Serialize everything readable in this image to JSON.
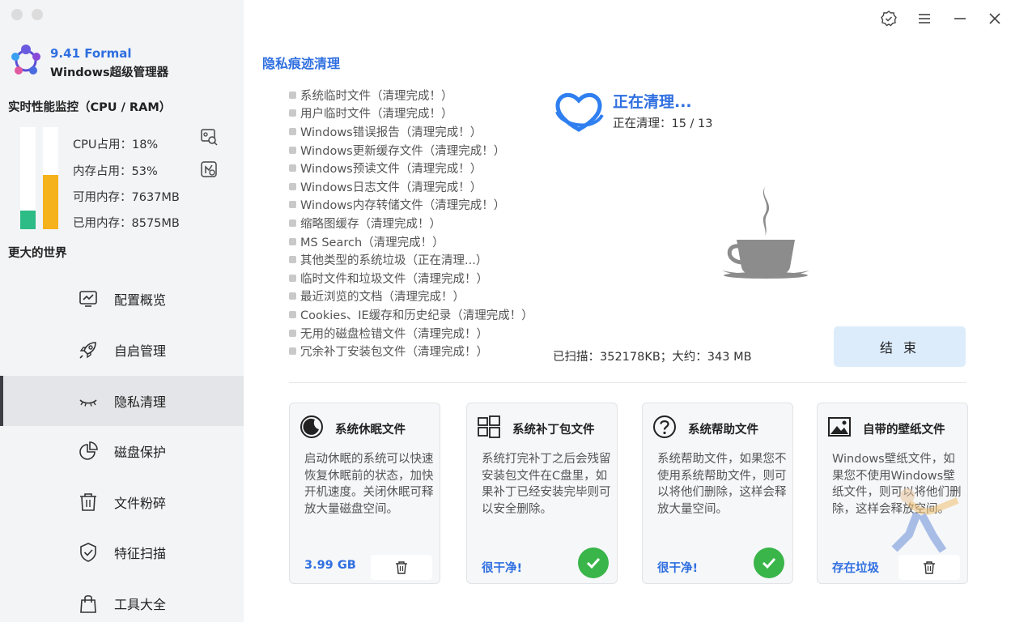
{
  "app": {
    "version": "9.41 Formal",
    "name": "Windows超级管理器"
  },
  "monitor": {
    "title": "实时性能监控（CPU / RAM）",
    "cpu_percent": 18,
    "mem_percent": 53,
    "cpu_color": "#2dbb86",
    "mem_color": "#f6b21b",
    "stats": [
      "CPU占用：18%",
      "内存占用：53%",
      "可用内存：7637MB",
      "已用内存：8575MB"
    ]
  },
  "sidebar": {
    "section_title": "更大的世界",
    "items": [
      {
        "label": "配置概览",
        "icon": "monitor-chart-icon"
      },
      {
        "label": "自启管理",
        "icon": "rocket-icon"
      },
      {
        "label": "隐私清理",
        "icon": "closed-eye-icon",
        "active": true
      },
      {
        "label": "磁盘保护",
        "icon": "pie-chart-icon"
      },
      {
        "label": "文件粉碎",
        "icon": "trash-icon"
      },
      {
        "label": "特征扫描",
        "icon": "shield-check-icon"
      },
      {
        "label": "工具大全",
        "icon": "bag-icon"
      }
    ]
  },
  "main": {
    "title": "隐私痕迹清理",
    "items": [
      "系统临时文件（清理完成！）",
      "用户临时文件（清理完成！）",
      "Windows错误报告（清理完成！）",
      "Windows更新缓存文件（清理完成！）",
      "Windows预读文件（清理完成！）",
      "Windows日志文件（清理完成！）",
      "Windows内存转储文件（清理完成！）",
      "缩略图缓存（清理完成！）",
      "MS Search（清理完成！）",
      "其他类型的系统垃圾（正在清理...）",
      "临时文件和垃圾文件（清理完成！）",
      "最近浏览的文档（清理完成！）",
      "Cookies、IE缓存和历史纪录（清理完成！）",
      "无用的磁盘检错文件（清理完成！）",
      "冗余补丁安装包文件（清理完成！）"
    ],
    "status_title": "正在清理...",
    "status_line": "正在清理：15 / 13",
    "scan_summary": "已扫描：352178KB；大约：343 MB",
    "end_label": "结 束"
  },
  "cards": [
    {
      "title": "系统休眠文件",
      "icon": "moon-icon",
      "desc": "启动休眠的系统可以快速恢复休眠前的状态，加快开机速度。关闭休眠可释放大量磁盘空间。",
      "value": "3.99 GB",
      "action": "trash"
    },
    {
      "title": "系统补丁包文件",
      "icon": "windows-grid-icon",
      "desc": "系统打完补丁之后会残留安装包文件在C盘里，如果补丁已经安装完毕则可以安全删除。",
      "value": "很干净!",
      "action": "check"
    },
    {
      "title": "系统帮助文件",
      "icon": "question-icon",
      "desc": "系统帮助文件，如果您不使用系统帮助文件，则可以将他们删除，这样会释放大量空间。",
      "value": "很干净!",
      "action": "check"
    },
    {
      "title": "自带的壁纸文件",
      "icon": "image-icon",
      "desc": "Windows壁纸文件，如果您不使用Windows壁纸文件，则可以将他们删除，这样会释放空间。",
      "value": "存在垃圾",
      "action": "trash"
    }
  ]
}
